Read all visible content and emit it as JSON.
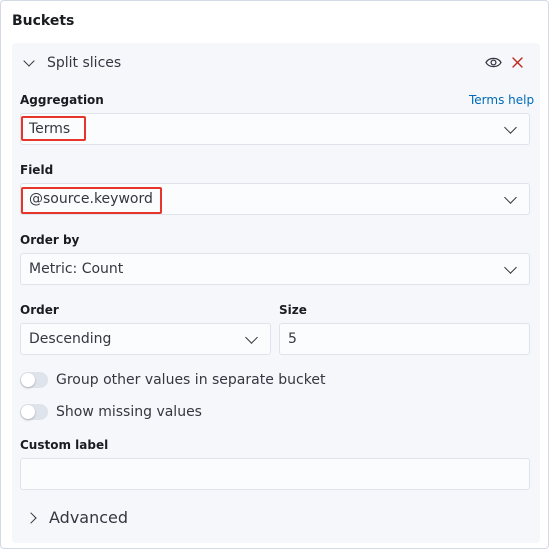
{
  "section_title": "Buckets",
  "panel": {
    "title": "Split slices"
  },
  "aggregation": {
    "label": "Aggregation",
    "help_link": "Terms help",
    "value": "Terms"
  },
  "field": {
    "label": "Field",
    "value": "@source.keyword"
  },
  "order_by": {
    "label": "Order by",
    "value": "Metric: Count"
  },
  "order": {
    "label": "Order",
    "value": "Descending"
  },
  "size": {
    "label": "Size",
    "value": "5"
  },
  "toggles": {
    "group_other": "Group other values in separate bucket",
    "show_missing": "Show missing values"
  },
  "custom_label": {
    "label": "Custom label",
    "value": ""
  },
  "advanced": {
    "label": "Advanced"
  },
  "colors": {
    "highlight": "#e7352b",
    "link": "#006bb8",
    "delete": "#bd271e"
  }
}
